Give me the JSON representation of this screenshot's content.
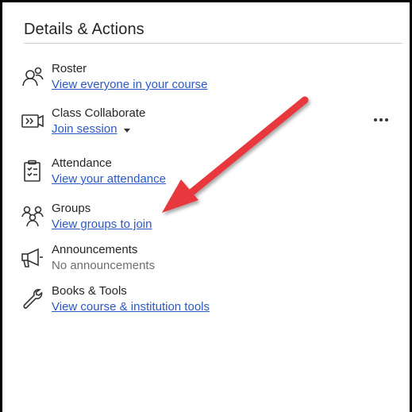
{
  "panel": {
    "title": "Details & Actions"
  },
  "items": [
    {
      "name": "Roster",
      "link": "View everyone in your course",
      "icon": "roster-icon"
    },
    {
      "name": "Class Collaborate",
      "link": "Join session",
      "icon": "collaborate-icon"
    },
    {
      "name": "Attendance",
      "link": "View your attendance",
      "icon": "attendance-icon"
    },
    {
      "name": "Groups",
      "link": "View groups to join",
      "icon": "groups-icon"
    },
    {
      "name": "Announcements",
      "status": "No announcements",
      "icon": "megaphone-icon"
    },
    {
      "name": "Books & Tools",
      "link": "View course & institution tools",
      "icon": "wrench-icon"
    }
  ],
  "annotation": {
    "arrow_color": "#e8383d"
  },
  "colors": {
    "link": "#2b59c3",
    "text": "#262626",
    "muted": "#6e6e6e"
  }
}
